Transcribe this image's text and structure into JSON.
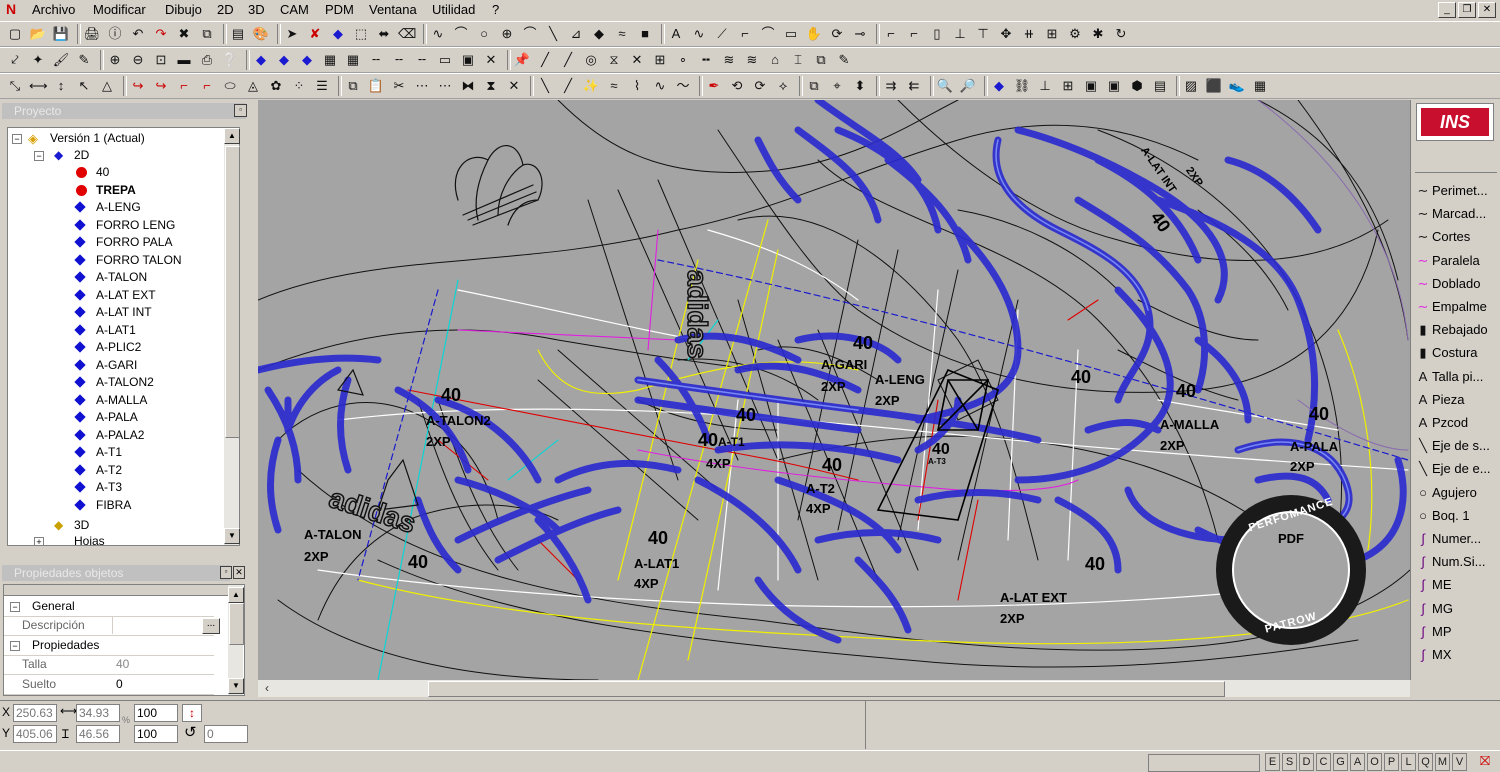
{
  "menu": {
    "items": [
      "Archivo",
      "Modificar",
      "Dibujo",
      "2D",
      "3D",
      "CAM",
      "PDM",
      "Ventana",
      "Utilidad",
      "?"
    ]
  },
  "project_panel": {
    "title": "Proyecto",
    "root": "Versión 1 (Actual)",
    "group_2d": "2D",
    "items": [
      {
        "label": "40",
        "icon": "red-dot"
      },
      {
        "label": "TREPA",
        "icon": "red-dot",
        "bold": true
      },
      {
        "label": "A-LENG",
        "icon": "blue-diamond"
      },
      {
        "label": "FORRO LENG",
        "icon": "blue-diamond"
      },
      {
        "label": "FORRO PALA",
        "icon": "blue-diamond"
      },
      {
        "label": "FORRO TALON",
        "icon": "blue-diamond"
      },
      {
        "label": "A-TALON",
        "icon": "blue-diamond"
      },
      {
        "label": "A-LAT EXT",
        "icon": "blue-diamond"
      },
      {
        "label": "A-LAT INT",
        "icon": "blue-diamond"
      },
      {
        "label": "A-LAT1",
        "icon": "blue-diamond"
      },
      {
        "label": "A-PLIC2",
        "icon": "blue-diamond"
      },
      {
        "label": "A-GARI",
        "icon": "blue-diamond"
      },
      {
        "label": "A-TALON2",
        "icon": "blue-diamond"
      },
      {
        "label": "A-MALLA",
        "icon": "blue-diamond"
      },
      {
        "label": "A-PALA",
        "icon": "blue-diamond"
      },
      {
        "label": "A-PALA2",
        "icon": "blue-diamond"
      },
      {
        "label": "A-T1",
        "icon": "blue-diamond"
      },
      {
        "label": "A-T2",
        "icon": "blue-diamond"
      },
      {
        "label": "A-T3",
        "icon": "blue-diamond"
      },
      {
        "label": "FIBRA",
        "icon": "blue-diamond"
      }
    ],
    "group_3d": "3D",
    "group_hojas": "Hojas"
  },
  "properties_panel": {
    "title": "Propiedades objetos",
    "general_label": "General",
    "descripcion_label": "Descripción",
    "descripcion_button": "...",
    "propiedades_label": "Propiedades",
    "talla_label": "Talla",
    "talla_value": "40",
    "suelto_label": "Suelto",
    "suelto_value": "0"
  },
  "palette": {
    "items": [
      "Perimet...",
      "Marcad...",
      "Cortes",
      "Paralela",
      "Doblado",
      "Empalme",
      "Rebajado",
      "Costura",
      "Talla pi...",
      "Pieza",
      "Pzcod",
      "Eje de s...",
      "Eje de e...",
      "Agujero",
      "Boq. 1",
      "Numer...",
      "Num.Si...",
      "ME",
      "MG",
      "MP",
      "MX"
    ],
    "icons": [
      "curve-icon",
      "curve-icon",
      "curve-icon",
      "curve-pink-icon",
      "curve-pink-icon",
      "curve-pink-icon",
      "pencil-icon",
      "pencil-icon",
      "letter-a-icon",
      "letter-a-icon",
      "letter-a-icon",
      "dashed-line-icon",
      "dashed-line-icon",
      "circle-icon",
      "circle-icon",
      "pen-icon",
      "pen-icon",
      "pen-icon",
      "pen-icon",
      "pen-icon",
      "pen-icon"
    ]
  },
  "canvas": {
    "labels": [
      {
        "text": "40"
      },
      {
        "text": "A-TALON2"
      },
      {
        "text": "2XP"
      },
      {
        "text": "40"
      },
      {
        "text": "A-GARI"
      },
      {
        "text": "2XP"
      },
      {
        "text": "A-LENG"
      },
      {
        "text": "2XP"
      },
      {
        "text": "40"
      },
      {
        "text": "40"
      },
      {
        "text": "A-T1"
      },
      {
        "text": "4XP"
      },
      {
        "text": "40"
      },
      {
        "text": "A-T2"
      },
      {
        "text": "4XP"
      },
      {
        "text": "40"
      },
      {
        "text": "A-T3"
      },
      {
        "text": "40"
      },
      {
        "text": "40"
      },
      {
        "text": "A-MALLA"
      },
      {
        "text": "2XP"
      },
      {
        "text": "40"
      },
      {
        "text": "A-PALA"
      },
      {
        "text": "2XP"
      },
      {
        "text": "A-TALON"
      },
      {
        "text": "2XP"
      },
      {
        "text": "40"
      },
      {
        "text": "40"
      },
      {
        "text": "A-LAT1"
      },
      {
        "text": "4XP"
      },
      {
        "text": "40"
      },
      {
        "text": "A-LAT EXT"
      },
      {
        "text": "2XP"
      },
      {
        "text": "40"
      },
      {
        "text": "A-LAT INT"
      },
      {
        "text": "2XP"
      },
      {
        "text": "adidas"
      },
      {
        "text": "adidas"
      }
    ],
    "watermark": {
      "top": "PERFOMANCE",
      "center": "PDF",
      "bottom": "PATROW"
    },
    "logo_text": "INS"
  },
  "status": {
    "x_label": "X",
    "y_label": "Y",
    "x_value": "250.63",
    "y_value": "405.06",
    "dx_value": "34.93",
    "dy_value": "46.56",
    "scale1": "100",
    "scale2": "100",
    "angle": "0",
    "flags": [
      "E",
      "S",
      "D",
      "C",
      "G",
      "A",
      "O",
      "P",
      "L",
      "Q",
      "M",
      "V"
    ]
  },
  "colors": {
    "canvas_bg": "#a4a4a4",
    "panel_title_bg": "#c0c0c0",
    "accent_blue": "#1a1ad0",
    "highlight_red": "#e00000"
  }
}
